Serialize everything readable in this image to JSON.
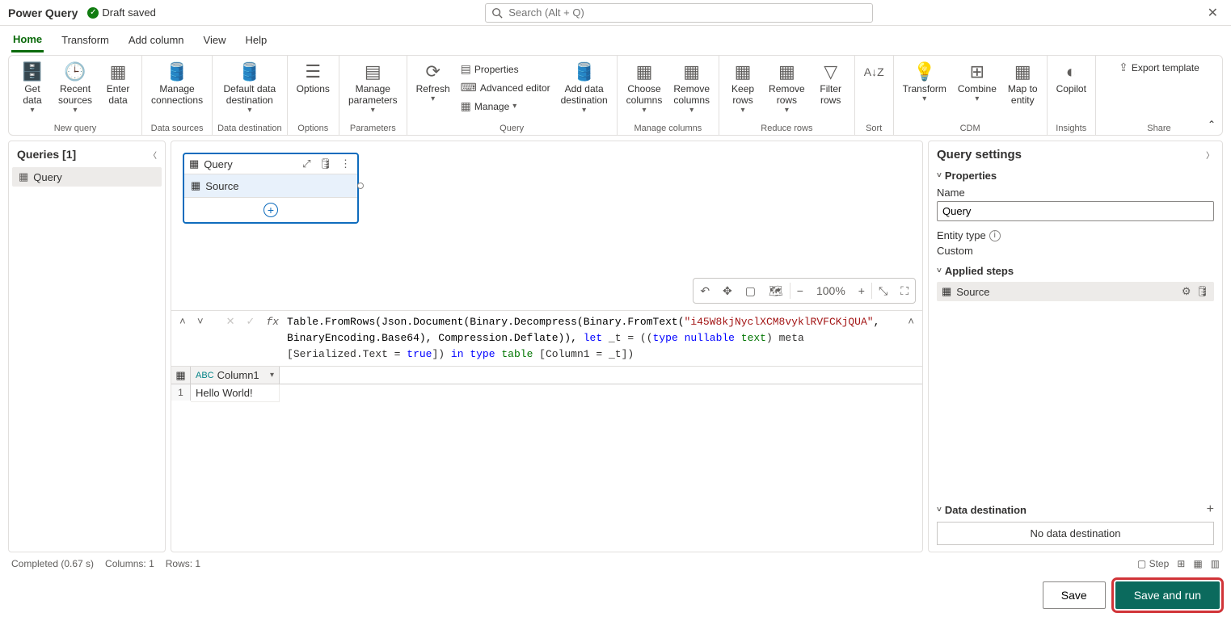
{
  "title": "Power Query",
  "draft_status": "Draft saved",
  "search_placeholder": "Search (Alt + Q)",
  "tabs": [
    "Home",
    "Transform",
    "Add column",
    "View",
    "Help"
  ],
  "ribbon": {
    "new_query": {
      "get_data": "Get\ndata",
      "recent_sources": "Recent\nsources",
      "enter_data": "Enter\ndata",
      "label": "New query"
    },
    "data_sources": {
      "manage_connections": "Manage\nconnections",
      "label": "Data sources"
    },
    "data_destination": {
      "default_dest": "Default data\ndestination",
      "label": "Data destination"
    },
    "options": {
      "options": "Options",
      "label": "Options"
    },
    "parameters": {
      "manage_params": "Manage\nparameters",
      "label": "Parameters"
    },
    "query": {
      "refresh": "Refresh",
      "properties": "Properties",
      "advanced_editor": "Advanced editor",
      "manage": "Manage",
      "add_dest": "Add data\ndestination",
      "label": "Query"
    },
    "manage_columns": {
      "choose": "Choose\ncolumns",
      "remove": "Remove\ncolumns",
      "label": "Manage columns"
    },
    "reduce_rows": {
      "keep": "Keep\nrows",
      "remove": "Remove\nrows",
      "filter": "Filter\nrows",
      "label": "Reduce rows"
    },
    "sort": {
      "label": "Sort"
    },
    "transform": {
      "transform": "Transform",
      "combine": "Combine",
      "map": "Map to\nentity",
      "cdm": "CDM"
    },
    "insights_g": {
      "copilot": "Copilot",
      "label": "Insights"
    },
    "share_g": {
      "export": "Export template",
      "label": "Share"
    }
  },
  "queries": {
    "header": "Queries [1]",
    "items": [
      "Query"
    ]
  },
  "diagram": {
    "card_title": "Query",
    "step": "Source"
  },
  "canvas": {
    "zoom": "100%"
  },
  "formula": {
    "p1": "Table.FromRows(Json.Document(Binary.Decompress(Binary.FromText(",
    "str": "\"i45W8kjNyclXCM8vyklRVFCKjQUA\"",
    "p2": ", BinaryEncoding.Base64), Compression.Deflate)), ",
    "kw_let": "let",
    "p3": " _t = ((",
    "kw_type1": "type",
    "kw_nullable": " nullable ",
    "kw_text": "text",
    "p4": ") meta [Serialized.Text = ",
    "kw_true": "true",
    "p5": "]) ",
    "kw_in": "in",
    "p6": " ",
    "kw_type2": "type",
    "p7": " ",
    "kw_table": "table",
    "p8": " [Column1 = _t])"
  },
  "grid": {
    "col1": "Column1",
    "row1": "1",
    "cell1": "Hello World!"
  },
  "settings": {
    "title": "Query settings",
    "properties": "Properties",
    "name_label": "Name",
    "name_value": "Query",
    "entity_type_label": "Entity type",
    "entity_type_value": "Custom",
    "applied_steps": "Applied steps",
    "step_source": "Source",
    "data_destination": "Data destination",
    "no_destination": "No data destination"
  },
  "status": {
    "completed": "Completed (0.67 s)",
    "columns": "Columns: 1",
    "rows": "Rows: 1",
    "step": "Step"
  },
  "footer": {
    "save": "Save",
    "save_run": "Save and run"
  }
}
